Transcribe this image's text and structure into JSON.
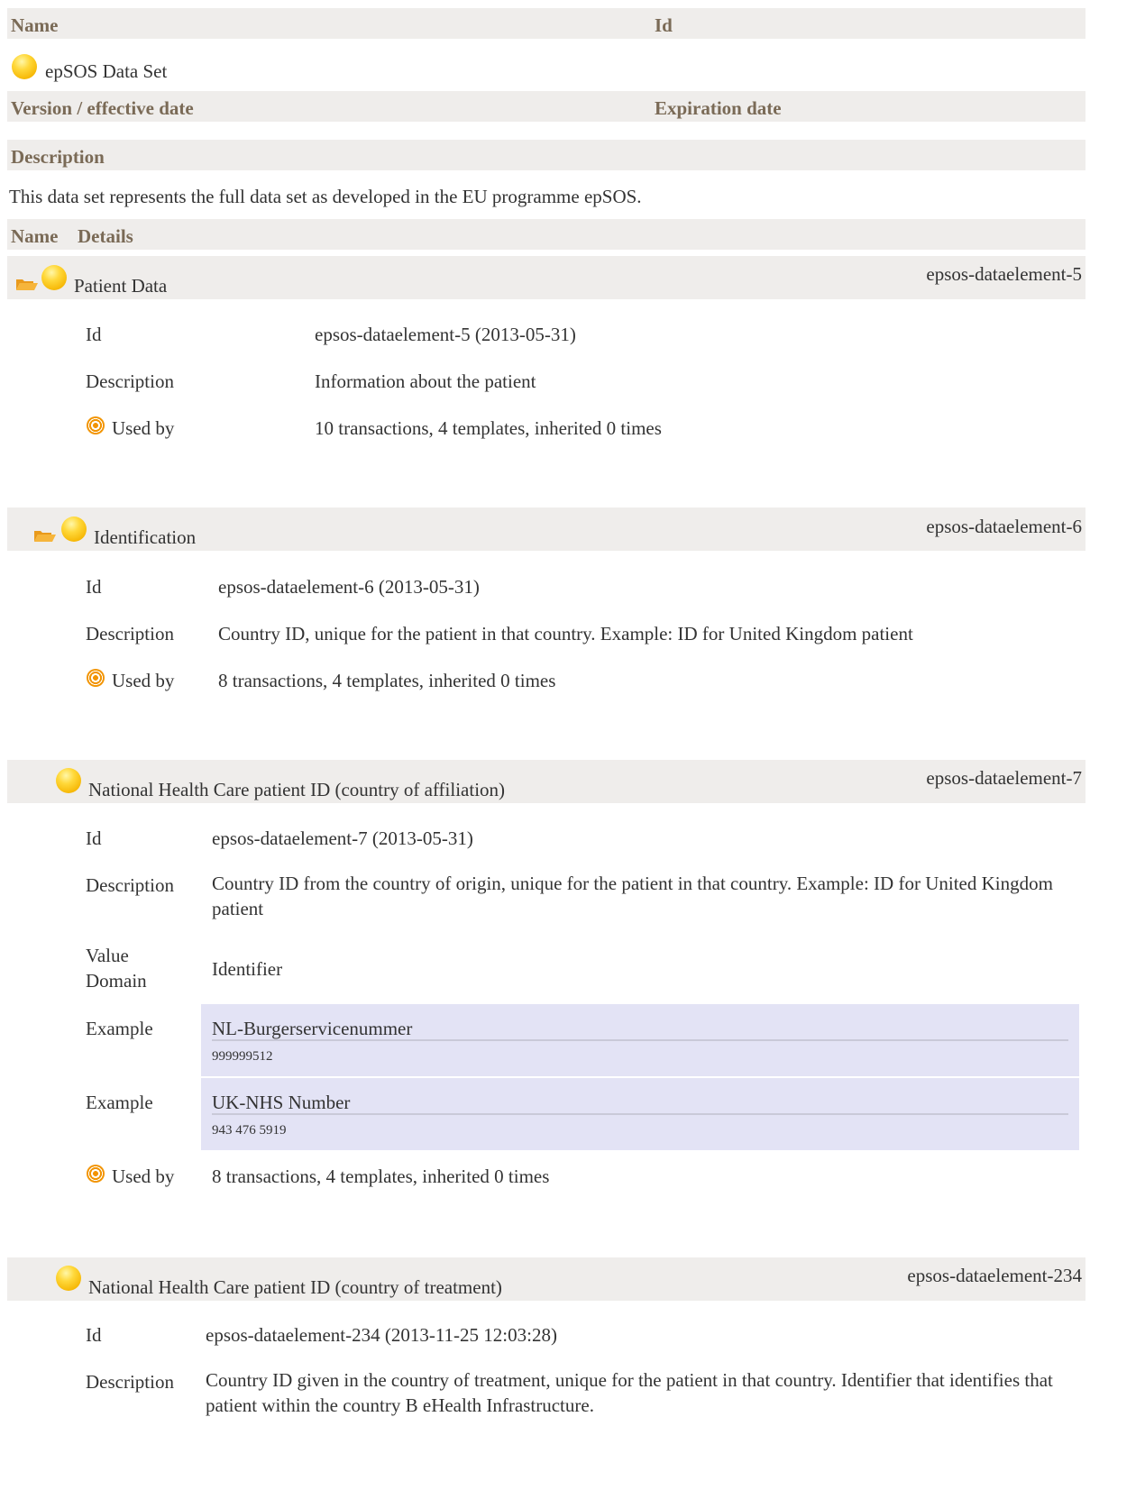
{
  "header": {
    "col_name": "Name",
    "col_id": "Id",
    "dataset_name": "epSOS Data Set",
    "col_version": "Version / effective date",
    "col_expiration": "Expiration date",
    "description_label": "Description",
    "description_text": "This data set represents the full data set as developed in the EU programme epSOS.",
    "col_name2": "Name",
    "col_details": "Details"
  },
  "elements": [
    {
      "title": "Patient Data",
      "ref": "epsos-dataelement-5",
      "id_label": "Id",
      "id_value": "epsos-dataelement-5 (2013-05-31)",
      "desc_label": "Description",
      "desc_value": "Information about the patient",
      "usedby_label": "Used by",
      "usedby_value": "10 transactions, 4 templates, inherited 0 times"
    },
    {
      "title": "Identification",
      "ref": "epsos-dataelement-6",
      "id_label": "Id",
      "id_value": "epsos-dataelement-6 (2013-05-31)",
      "desc_label": "Description",
      "desc_value": "Country ID, unique for the patient in that country. Example: ID for United Kingdom patient",
      "usedby_label": "Used by",
      "usedby_value": "8 transactions, 4 templates, inherited 0 times"
    },
    {
      "title": "National Health Care patient ID (country of affiliation)",
      "ref": "epsos-dataelement-7",
      "id_label": "Id",
      "id_value": "epsos-dataelement-7 (2013-05-31)",
      "desc_label": "Description",
      "desc_value": "Country ID from the country of origin, unique for the patient in that country. Example: ID for United Kingdom patient",
      "vd_label": "Value Domain",
      "vd_value": "Identifier",
      "examples": [
        {
          "label": "Example",
          "name": "NL-Burgerservicenummer",
          "value": "999999512"
        },
        {
          "label": "Example",
          "name": "UK-NHS Number",
          "value": "943 476 5919"
        }
      ],
      "usedby_label": "Used by",
      "usedby_value": "8 transactions, 4 templates, inherited 0 times"
    },
    {
      "title": "National Health Care patient ID (country of treatment)",
      "ref": "epsos-dataelement-234",
      "id_label": "Id",
      "id_value": "epsos-dataelement-234 (2013-11-25 12:03:28)",
      "desc_label": "Description",
      "desc_value": "Country ID given in the country of treatment, unique for the patient in that country. Identifier that identifies that patient within the country B eHealth Infrastructure."
    }
  ],
  "icons": {
    "concept": "concept-dot-icon",
    "folder": "open-folder-icon",
    "usedby": "target-icon"
  }
}
